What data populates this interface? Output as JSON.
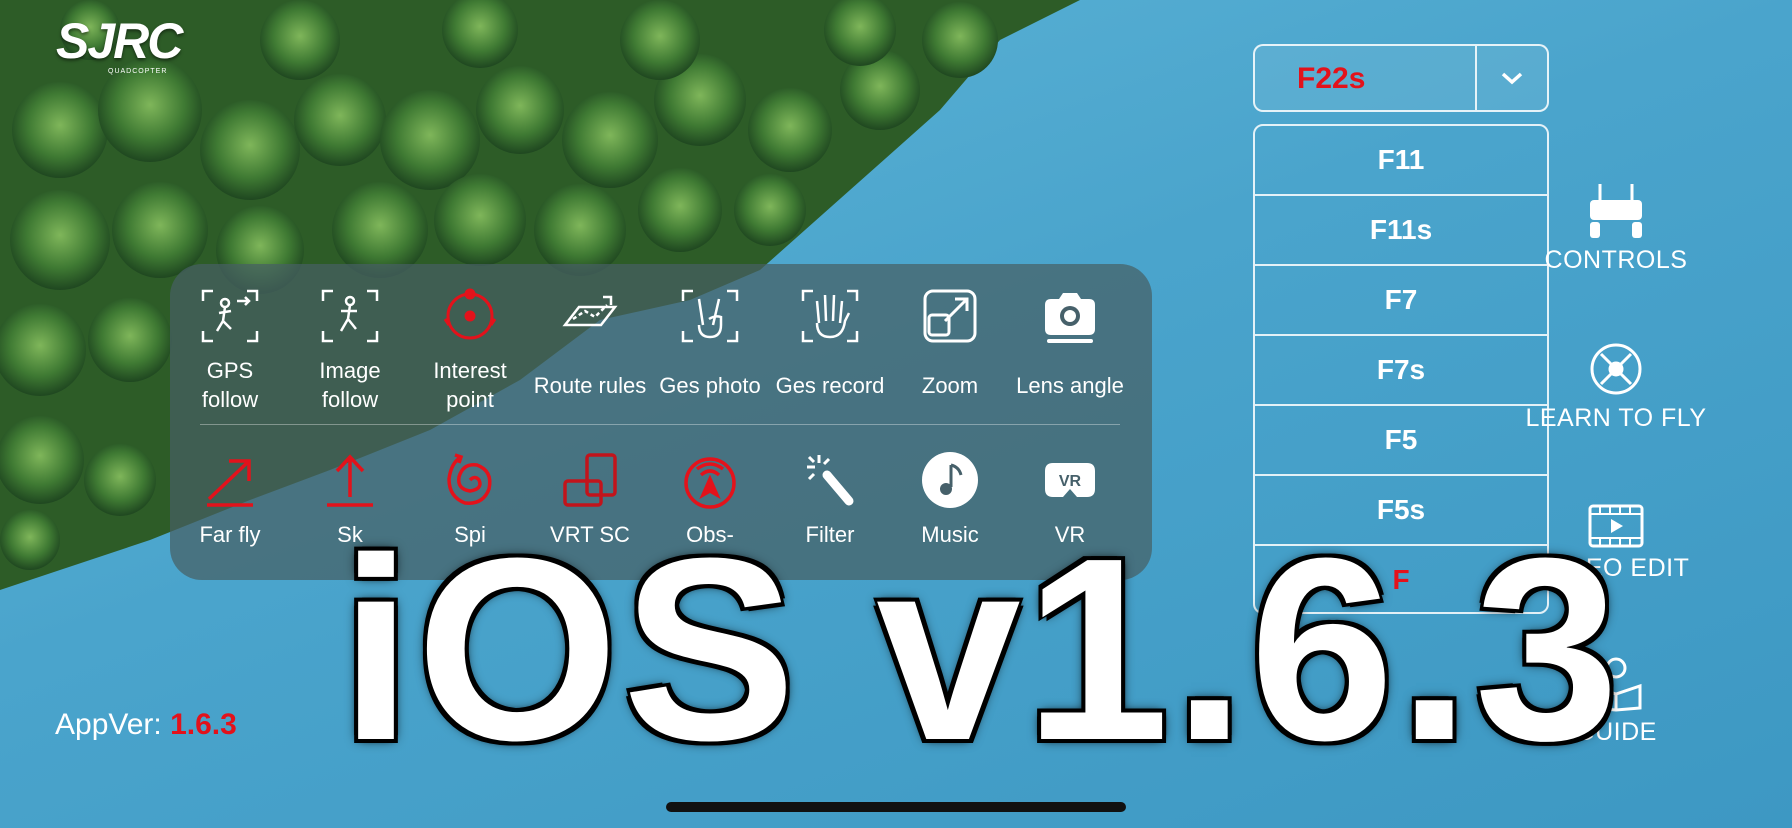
{
  "logo": {
    "main": "SJRC",
    "sub": "QUADCOPTER"
  },
  "toolbar": {
    "row1": [
      {
        "label": "GPS\nfollow",
        "icon": "gps-follow-icon",
        "color": "#ffffff"
      },
      {
        "label": "Image\nfollow",
        "icon": "image-follow-icon",
        "color": "#ffffff"
      },
      {
        "label": "Interest\npoint",
        "icon": "interest-point-icon",
        "color": "#e3121b"
      },
      {
        "label": "Route rules",
        "icon": "route-rules-icon",
        "color": "#ffffff"
      },
      {
        "label": "Ges photo",
        "icon": "gesture-photo-icon",
        "color": "#ffffff"
      },
      {
        "label": "Ges record",
        "icon": "gesture-record-icon",
        "color": "#ffffff"
      },
      {
        "label": "Zoom",
        "icon": "zoom-icon",
        "color": "#ffffff"
      },
      {
        "label": "Lens angle",
        "icon": "camera-icon",
        "color": "#ffffff"
      }
    ],
    "row2": [
      {
        "label": "Far fly",
        "icon": "far-fly-icon",
        "color": "#e3121b"
      },
      {
        "label": "Sk",
        "icon": "sky-icon",
        "color": "#e3121b"
      },
      {
        "label": "Spi",
        "icon": "spiral-icon",
        "color": "#e3121b"
      },
      {
        "label": "VRT SC",
        "icon": "vertical-screen-icon",
        "color": "#e3121b"
      },
      {
        "label": "Obs-\ne",
        "icon": "obstacle-icon",
        "color": "#e3121b"
      },
      {
        "label": "Filter",
        "icon": "filter-wand-icon",
        "color": "#ffffff"
      },
      {
        "label": "Music",
        "icon": "music-icon",
        "color": "#ffffff"
      },
      {
        "label": "VR",
        "icon": "vr-headset-icon",
        "color": "#ffffff"
      }
    ]
  },
  "model_select": {
    "selected": "F22s",
    "options": [
      "F11",
      "F11s",
      "F7",
      "F7s",
      "F5",
      "F5s",
      "F"
    ]
  },
  "side_menu": {
    "controls": "CONTROLS",
    "learn": "LEARN TO FLY",
    "video": "VIDEO EDIT",
    "guide": "GUIDE"
  },
  "app_version": {
    "label": "AppVer: ",
    "value": "1.6.3"
  },
  "overlay_text": "iOS v1.6.3",
  "colors": {
    "accent_red": "#e3121b",
    "water": "#4aa4cc",
    "forest": "#2f5a2a"
  }
}
